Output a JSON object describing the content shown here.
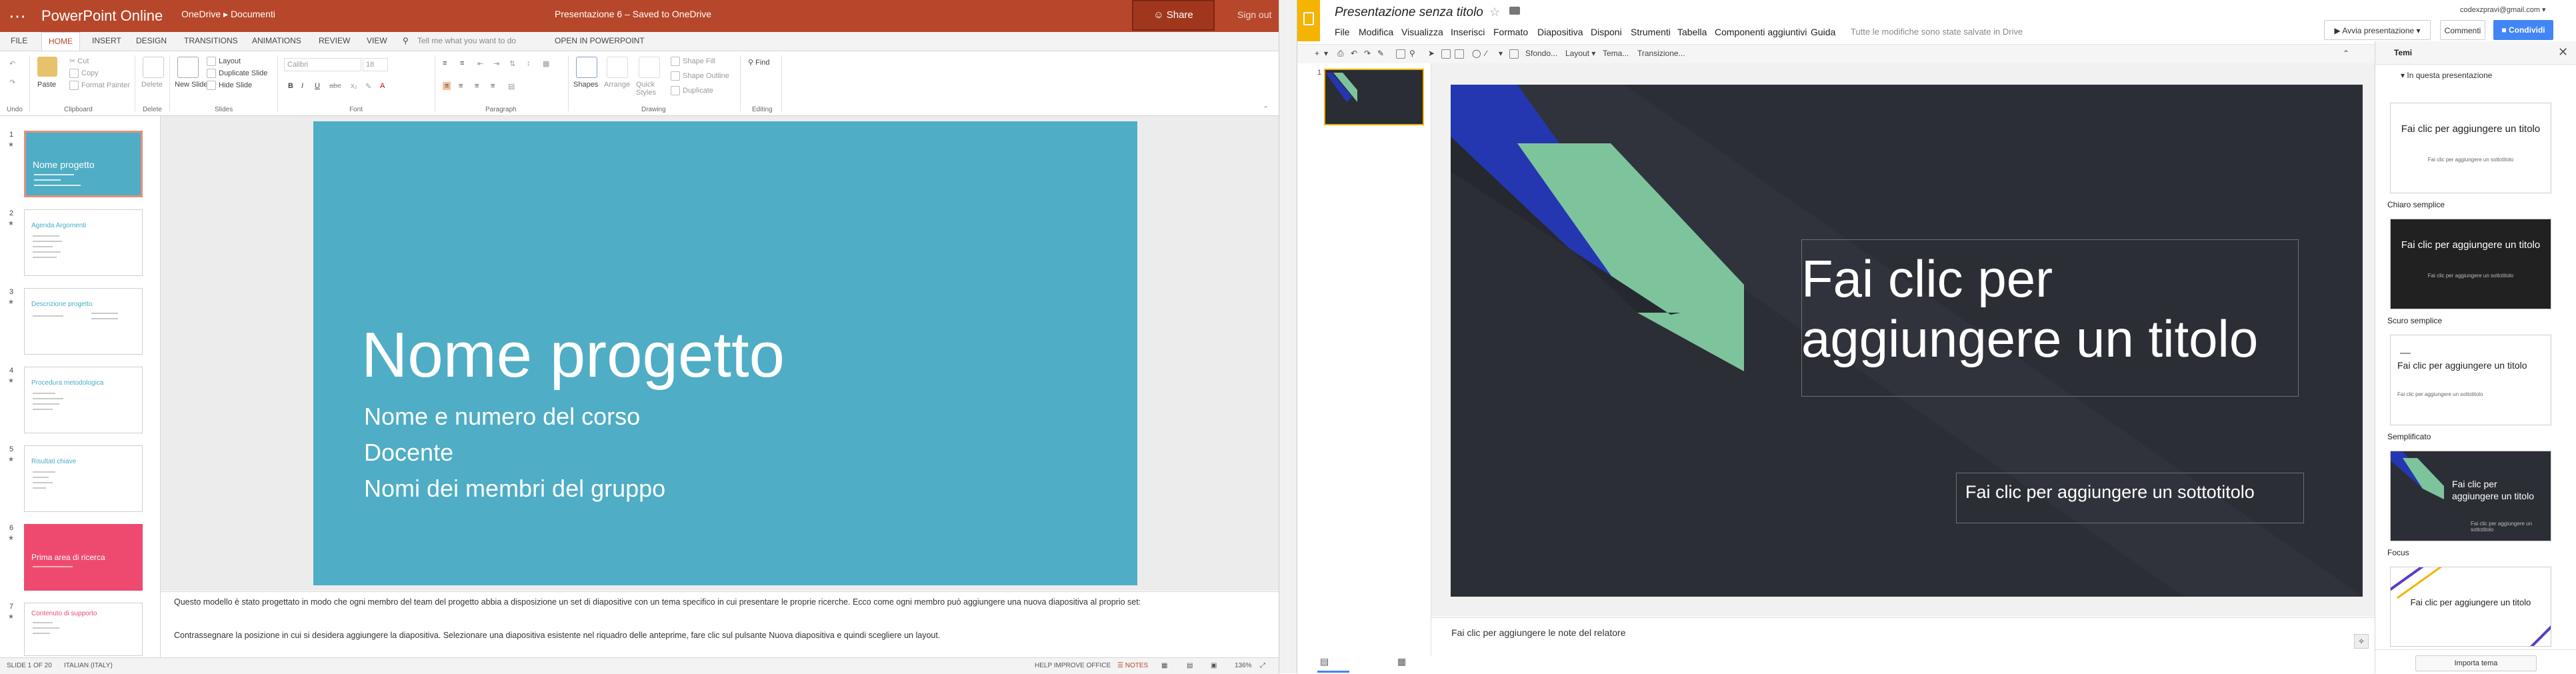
{
  "ppt": {
    "app_name": "PowerPoint Online",
    "breadcrumb": "OneDrive ▸ Documenti",
    "doc_title": "Presentazione 6   –   Saved to OneDrive",
    "share_label": "Share",
    "signout_label": "Sign out",
    "tabs": [
      "FILE",
      "HOME",
      "INSERT",
      "DESIGN",
      "TRANSITIONS",
      "ANIMATIONS",
      "REVIEW",
      "VIEW"
    ],
    "tell_me": "Tell me what you want to do",
    "open_in": "OPEN IN POWERPOINT",
    "ribbon": {
      "undo": "Undo",
      "paste": "Paste",
      "cut": "Cut",
      "copy": "Copy",
      "format_painter": "Format Painter",
      "delete": "Delete",
      "new_slide": "New Slide",
      "layout": "Layout",
      "duplicate": "Duplicate Slide",
      "hide": "Hide Slide",
      "font_name": "Calibri",
      "font_size": "18",
      "shapes": "Shapes",
      "arrange": "Arrange",
      "quick_styles": "Quick Styles",
      "shape_fill": "Shape Fill",
      "shape_outline": "Shape Outline",
      "duplicate_shape": "Duplicate",
      "find": "Find",
      "groups": [
        "Undo",
        "Clipboard",
        "Delete",
        "Slides",
        "Font",
        "Paragraph",
        "Drawing",
        "Editing"
      ]
    },
    "thumbnails": [
      {
        "num": "1",
        "title": "Nome progetto",
        "color": "#4fadc5",
        "selected": true
      },
      {
        "num": "2",
        "title": "Agenda Argomenti",
        "color": "#ffffff",
        "selected": false
      },
      {
        "num": "3",
        "title": "Descrizione progetto",
        "color": "#ffffff",
        "selected": false
      },
      {
        "num": "4",
        "title": "Procedura metodologica",
        "color": "#ffffff",
        "selected": false
      },
      {
        "num": "5",
        "title": "Risultati chiave",
        "color": "#ffffff",
        "selected": false
      },
      {
        "num": "6",
        "title": "Prima area di ricerca",
        "color": "#ee4a6f",
        "selected": false
      },
      {
        "num": "7",
        "title": "Contenuto di supporto",
        "color": "#ffffff",
        "selected": false
      }
    ],
    "slide": {
      "title": "Nome progetto",
      "subtitles": [
        "Nome e numero del corso",
        "Docente",
        "Nomi dei membri del gruppo"
      ]
    },
    "notes": [
      "Questo modello è stato progettato in modo che ogni membro del team del progetto abbia a disposizione un set di diapositive con un tema specifico in cui presentare le proprie ricerche. Ecco come ogni membro può aggiungere una nuova diapositiva al proprio set:",
      "Contrassegnare la posizione in cui si desidera aggiungere la diapositiva. Selezionare una diapositiva esistente nel riquadro delle anteprime, fare clic sul pulsante Nuova diapositiva e quindi scegliere un layout."
    ],
    "status": {
      "slide_of": "SLIDE 1 OF 20",
      "language": "ITALIAN (ITALY)",
      "help": "HELP IMPROVE OFFICE",
      "notes_btn": "NOTES",
      "zoom": "136%"
    }
  },
  "gs": {
    "title": "Presentazione senza titolo",
    "menus": [
      "File",
      "Modifica",
      "Visualizza",
      "Inserisci",
      "Formato",
      "Diapositiva",
      "Disponi",
      "Strumenti",
      "Tabella",
      "Componenti aggiuntivi",
      "Guida"
    ],
    "saved": "Tutte le modifiche sono state salvate in Drive",
    "account": "codexzpravi@gmail.com ▾",
    "present": "Avvia presentazione",
    "comments": "Commenti",
    "share": "Condividi",
    "toolbar": {
      "bg": "Sfondo...",
      "layout": "Layout ▾",
      "theme": "Tema...",
      "transition": "Transizione..."
    },
    "slide_num": "1",
    "slide": {
      "title": "Fai clic per aggiungere un titolo",
      "subtitle": "Fai clic per aggiungere un sottotitolo"
    },
    "notes": "Fai clic per aggiungere le note del relatore",
    "themes": {
      "header": "Temi",
      "section": "▾  In questa presentazione",
      "items": [
        {
          "name": "Chiaro semplice",
          "title": "Fai clic per aggiungere un titolo",
          "sub": "Fai clic per aggiungere un sottotitolo",
          "bg": "#ffffff",
          "fg": "#222222"
        },
        {
          "name": "Scuro semplice",
          "title": "Fai clic per aggiungere un titolo",
          "sub": "Fai clic per aggiungere un sottotitolo",
          "bg": "#212121",
          "fg": "#ffffff"
        },
        {
          "name": "Semplificato",
          "title": "Fai clic per aggiungere un titolo",
          "sub": "Fai clic per aggiungere un sottotitolo",
          "bg": "#ffffff",
          "fg": "#222222"
        },
        {
          "name": "Focus",
          "title": "Fai clic per aggiungere un titolo",
          "sub": "Fai clic per aggiungere un sottotitolo",
          "bg": "#2b2e35",
          "fg": "#ffffff"
        },
        {
          "name": "",
          "title": "Fai clic per aggiungere un titolo",
          "sub": "",
          "bg": "#ffffff",
          "fg": "#222222"
        }
      ],
      "import": "Importa tema"
    }
  },
  "colors": {
    "ppt_brand": "#b7472a",
    "ppt_slide": "#4fadc5",
    "gs_brand": "#f4b400",
    "gs_slide": "#2b2e35",
    "gs_share": "#4285f4",
    "accent_blue": "#2437b0",
    "accent_green": "#7dc49d"
  }
}
